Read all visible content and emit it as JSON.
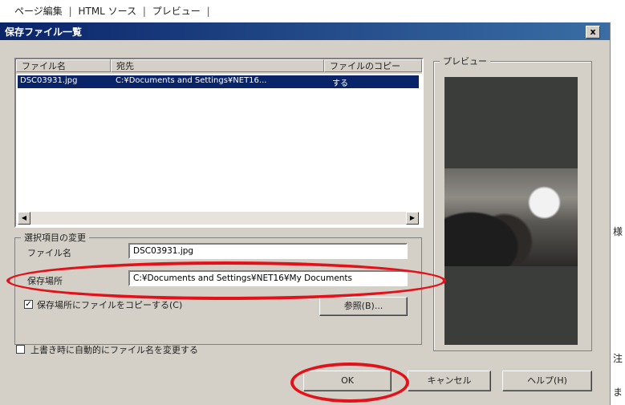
{
  "tabbar": {
    "tabs": [
      "ページ編集",
      "HTML ソース",
      "プレビュー"
    ],
    "separator": "|"
  },
  "dialog": {
    "title": "保存ファイル一覧",
    "close_label": "x",
    "list": {
      "columns": [
        "ファイル名",
        "宛先",
        "ファイルのコピー"
      ],
      "rows": [
        {
          "filename": "DSC03931.jpg",
          "destination": "C:¥Documents and Settings¥NET16...",
          "copy": "する"
        }
      ]
    },
    "preview_label": "プレビュー",
    "change_group_label": "選択項目の変更",
    "filename_label": "ファイル名",
    "filename_value": "DSC03931.jpg",
    "location_label": "保存場所",
    "location_value": "C:¥Documents and Settings¥NET16¥My Documents",
    "copy_checkbox_label": "保存場所にファイルをコピーする(C)",
    "copy_checked": true,
    "browse_label": "参照(B)...",
    "rename_checkbox_label": "上書き時に自動的にファイル名を変更する",
    "rename_checked": false,
    "ok_label": "OK",
    "cancel_label": "キャンセル",
    "help_label": "ヘルプ(H)"
  },
  "right_strip_chars": [
    "様",
    "注",
    "ま"
  ],
  "colors": {
    "highlight": "#0a246a",
    "annotation": "#e3121a",
    "dialog_bg": "#d4d0c8"
  }
}
